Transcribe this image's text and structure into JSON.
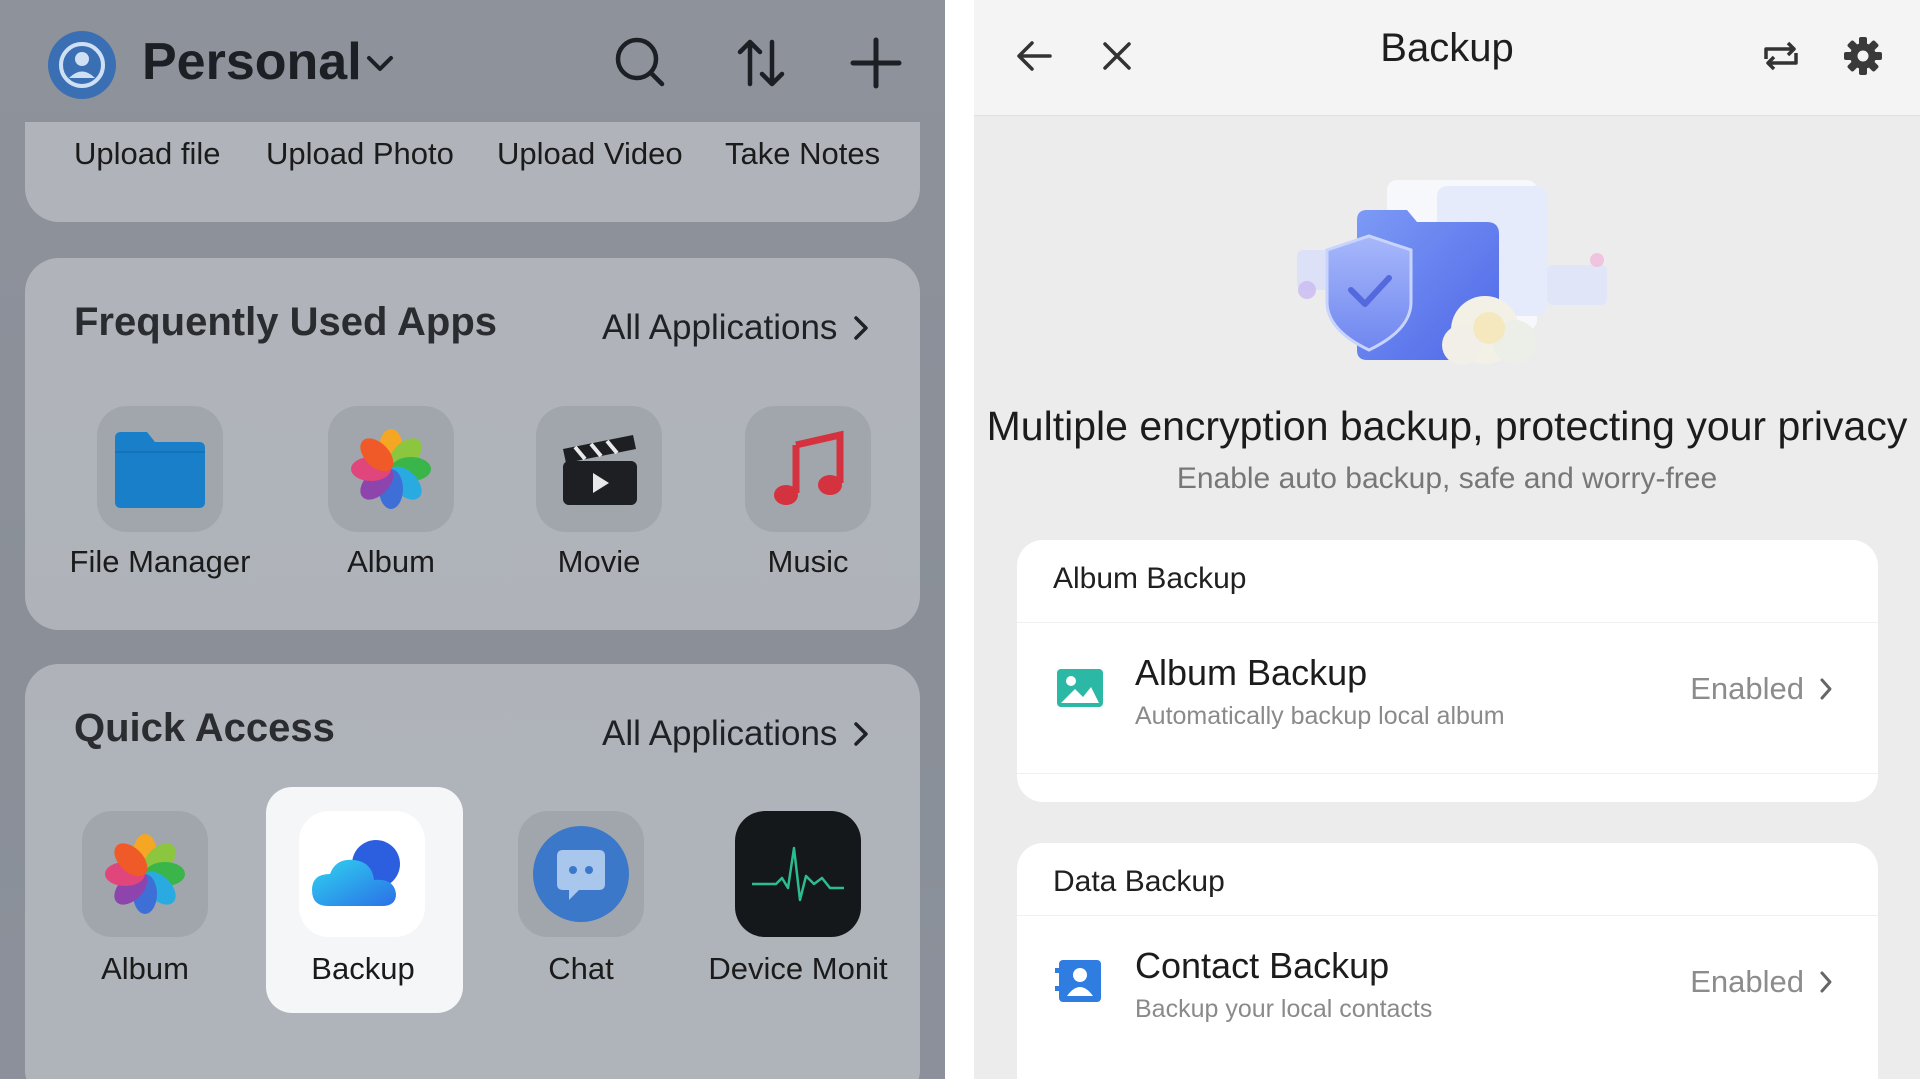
{
  "left": {
    "header": {
      "title": "Personal"
    },
    "upload": [
      "Upload file",
      "Upload Photo",
      "Upload Video",
      "Take Notes"
    ],
    "frequent": {
      "title": "Frequently Used Apps",
      "all_link": "All Applications",
      "apps": [
        "File Manager",
        "Album",
        "Movie",
        "Music"
      ]
    },
    "quick": {
      "title": "Quick Access",
      "all_link": "All Applications",
      "apps": [
        "Album",
        "Backup",
        "Chat",
        "Device Monit"
      ]
    }
  },
  "right": {
    "header": {
      "title": "Backup"
    },
    "headline": "Multiple encryption backup, protecting your privacy",
    "subline": "Enable auto backup, safe and worry-free",
    "album_section": {
      "label": "Album Backup",
      "item": {
        "title": "Album Backup",
        "subtitle": "Automatically backup local album",
        "status": "Enabled"
      }
    },
    "data_section": {
      "label": "Data Backup",
      "item": {
        "title": "Contact Backup",
        "subtitle": "Backup your local contacts",
        "status": "Enabled"
      }
    }
  },
  "colors": {
    "accent": "#2f7de0",
    "icon_teal": "#2bb8a5",
    "folder_blue": "#1a7fc9"
  }
}
